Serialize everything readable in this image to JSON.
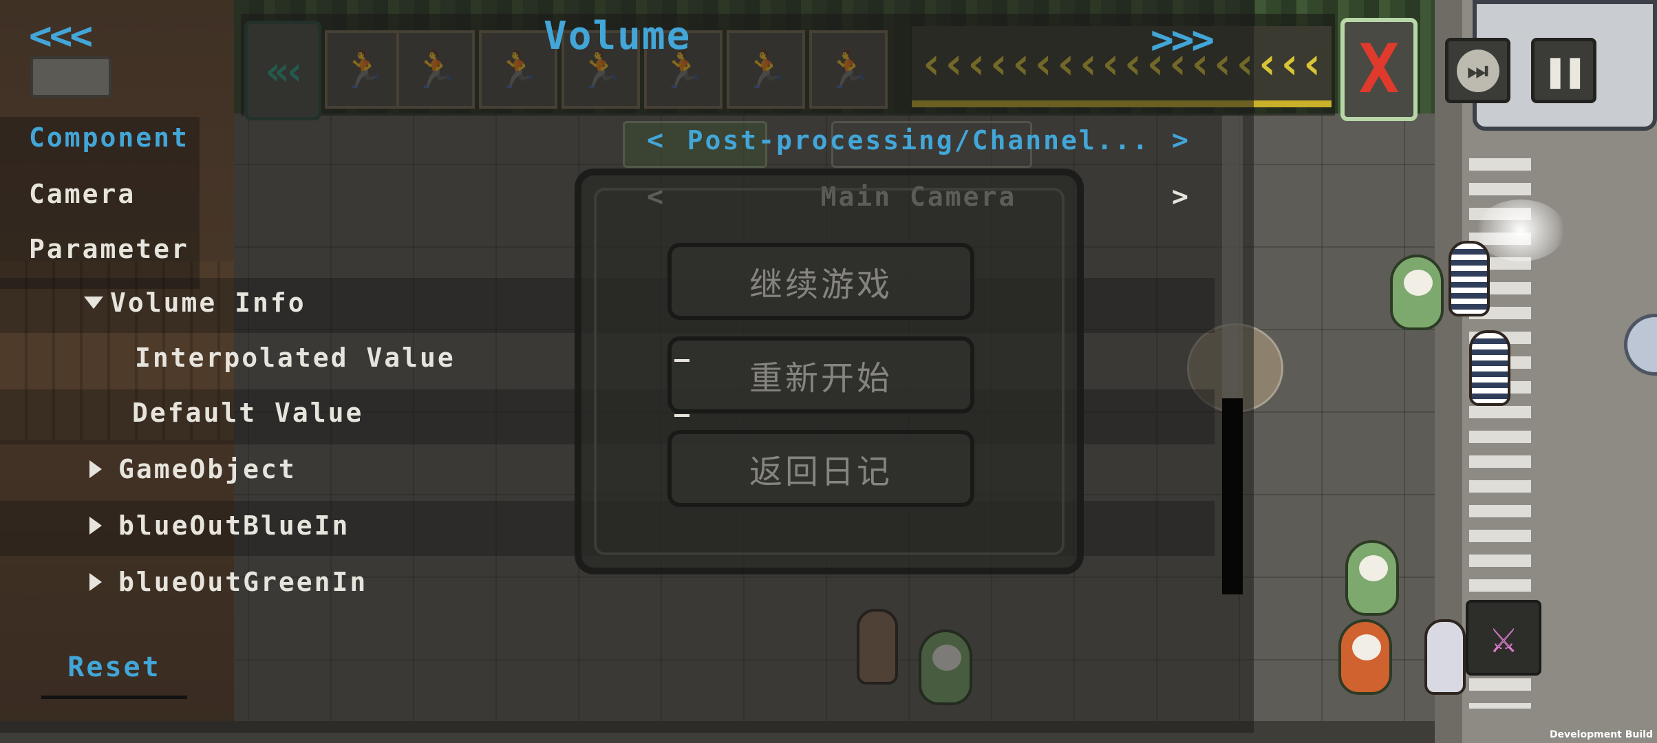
{
  "debug": {
    "back_arrows": "<<<",
    "title": "Volume",
    "forward_arrows": ">>>",
    "tabs": {
      "component": "Component",
      "camera": "Camera",
      "parameter": "Parameter"
    },
    "component_selector": {
      "prev": "<",
      "value": "Post-processing/Channel...",
      "next": ">"
    },
    "camera_selector": {
      "prev": "<",
      "value": "Main Camera",
      "next": ">"
    },
    "tree": {
      "volume_info": "Volume Info",
      "interpolated_value": "Interpolated Value",
      "interpolated_value_value": "–",
      "default_value": "Default Value",
      "default_value_value": "–",
      "game_object": "GameObject",
      "blue_out_blue_in": "blueOutBlueIn",
      "blue_out_green_in": "blueOutGreenIn"
    },
    "reset_label": "Reset",
    "scrollbar": {
      "thumb_fraction": 0.41
    }
  },
  "pause_menu": {
    "buttons": [
      "继续游戏",
      "重新开始",
      "返回日记"
    ]
  },
  "hud": {
    "close_glyph": "X",
    "close_color": "#e03a2d",
    "accent_color": "#42a6d8",
    "skip_icon": "skip-forward-icon",
    "pause_icon": "pause-icon"
  },
  "footer": {
    "build_label": "Development Build"
  }
}
